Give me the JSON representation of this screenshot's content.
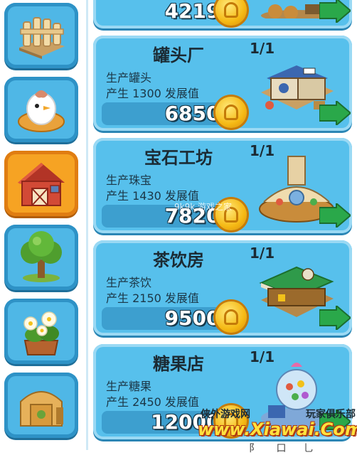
{
  "sidebar": {
    "categories": [
      {
        "icon": "fence-icon",
        "active": false
      },
      {
        "icon": "chicken-nest-icon",
        "active": false
      },
      {
        "icon": "barn-icon",
        "active": true
      },
      {
        "icon": "tree-icon",
        "active": false
      },
      {
        "icon": "flower-pot-icon",
        "active": false
      },
      {
        "icon": "shed-icon",
        "active": false
      }
    ]
  },
  "cards": [
    {
      "title": "",
      "line1": "",
      "line2": "",
      "price": "42195",
      "count": "",
      "building": "top-building"
    },
    {
      "title": "罐头厂",
      "line1": "生产罐头",
      "line2": "产生 1300 发展值",
      "price": "68500",
      "count": "1/1",
      "building": "cannery-building"
    },
    {
      "title": "宝石工坊",
      "line1": "生产珠宝",
      "line2": "产生 1430 发展值",
      "price": "78200",
      "count": "1/1",
      "building": "jewelry-workshop-building"
    },
    {
      "title": "茶饮房",
      "line1": "生产茶饮",
      "line2": "产生 2150 发展值",
      "price": "95000",
      "count": "1/1",
      "building": "tea-house-building"
    },
    {
      "title": "糖果店",
      "line1": "生产糖果",
      "line2": "产生 2450 发展值",
      "price": "120000",
      "count": "1/1",
      "building": "candy-shop-building"
    }
  ],
  "watermark": {
    "left_text": "侠外游戏网",
    "right_text": "玩家俱乐部",
    "main_text": "www.Xiawai.Com",
    "bottom_glyphs": "阝 口 乚",
    "center_text": "9k9k 游戏之家"
  },
  "colors": {
    "card_bg": "#57c0ec",
    "sidebar_bg": "#4fb7e6",
    "sidebar_active": "#f6a323",
    "coin": "#f5b914"
  }
}
